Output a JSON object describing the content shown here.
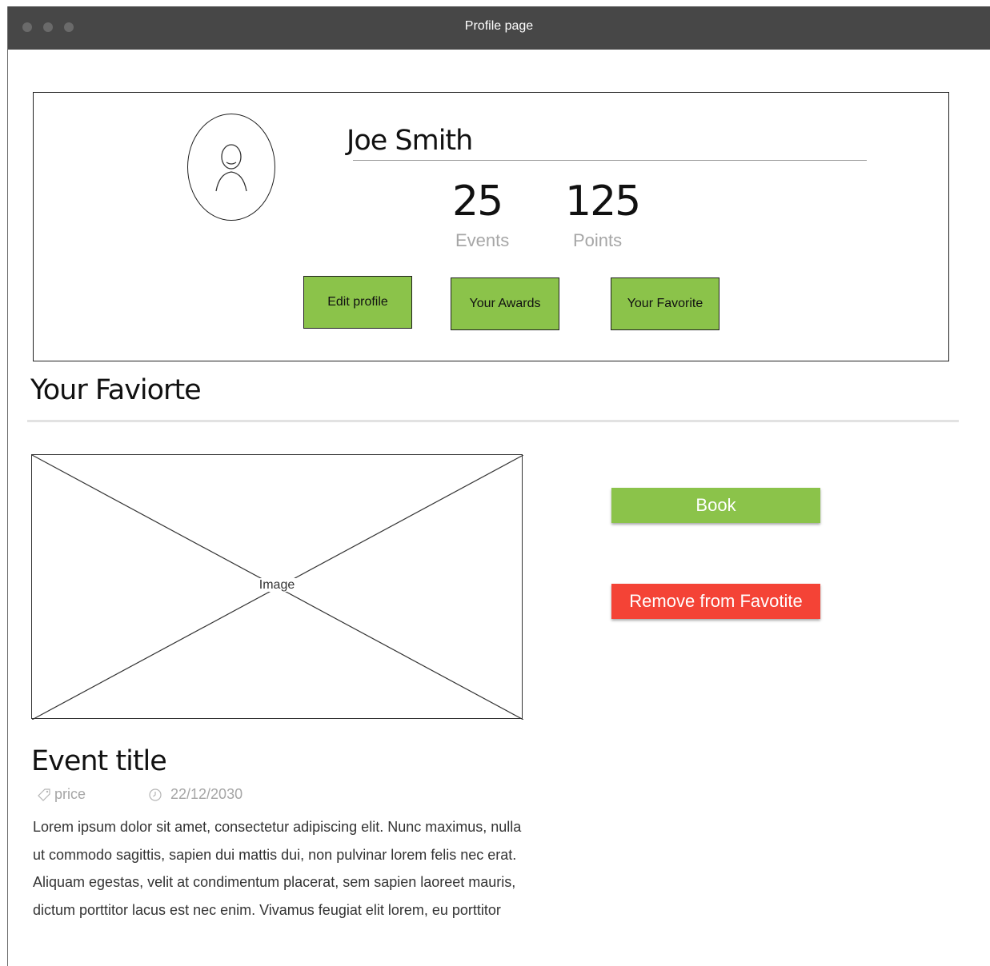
{
  "window": {
    "title": "Profile page"
  },
  "profile": {
    "name": "Joe Smith",
    "stats": [
      {
        "value": "25",
        "label": "Events"
      },
      {
        "value": "125",
        "label": "Points"
      }
    ],
    "buttons": {
      "edit": "Edit profile",
      "awards": "Your Awards",
      "favorite": "Your Favorite"
    }
  },
  "favorites": {
    "heading": "Your Faviorte",
    "image_label": "Image",
    "event": {
      "title": "Event title",
      "price": "price",
      "date": "22/12/2030",
      "description": "Lorem ipsum dolor sit amet, consectetur adipiscing elit. Nunc maximus, nulla ut commodo sagittis, sapien dui mattis dui, non pulvinar lorem felis nec erat. Aliquam egestas, velit at condimentum placerat, sem sapien laoreet mauris, dictum porttitor lacus est nec enim. Vivamus feugiat elit lorem, eu porttitor"
    },
    "actions": {
      "book": "Book",
      "remove": "Remove from Favotite"
    }
  },
  "colors": {
    "accent_green": "#8bc34a",
    "danger_red": "#f44336",
    "titlebar": "#474747"
  }
}
